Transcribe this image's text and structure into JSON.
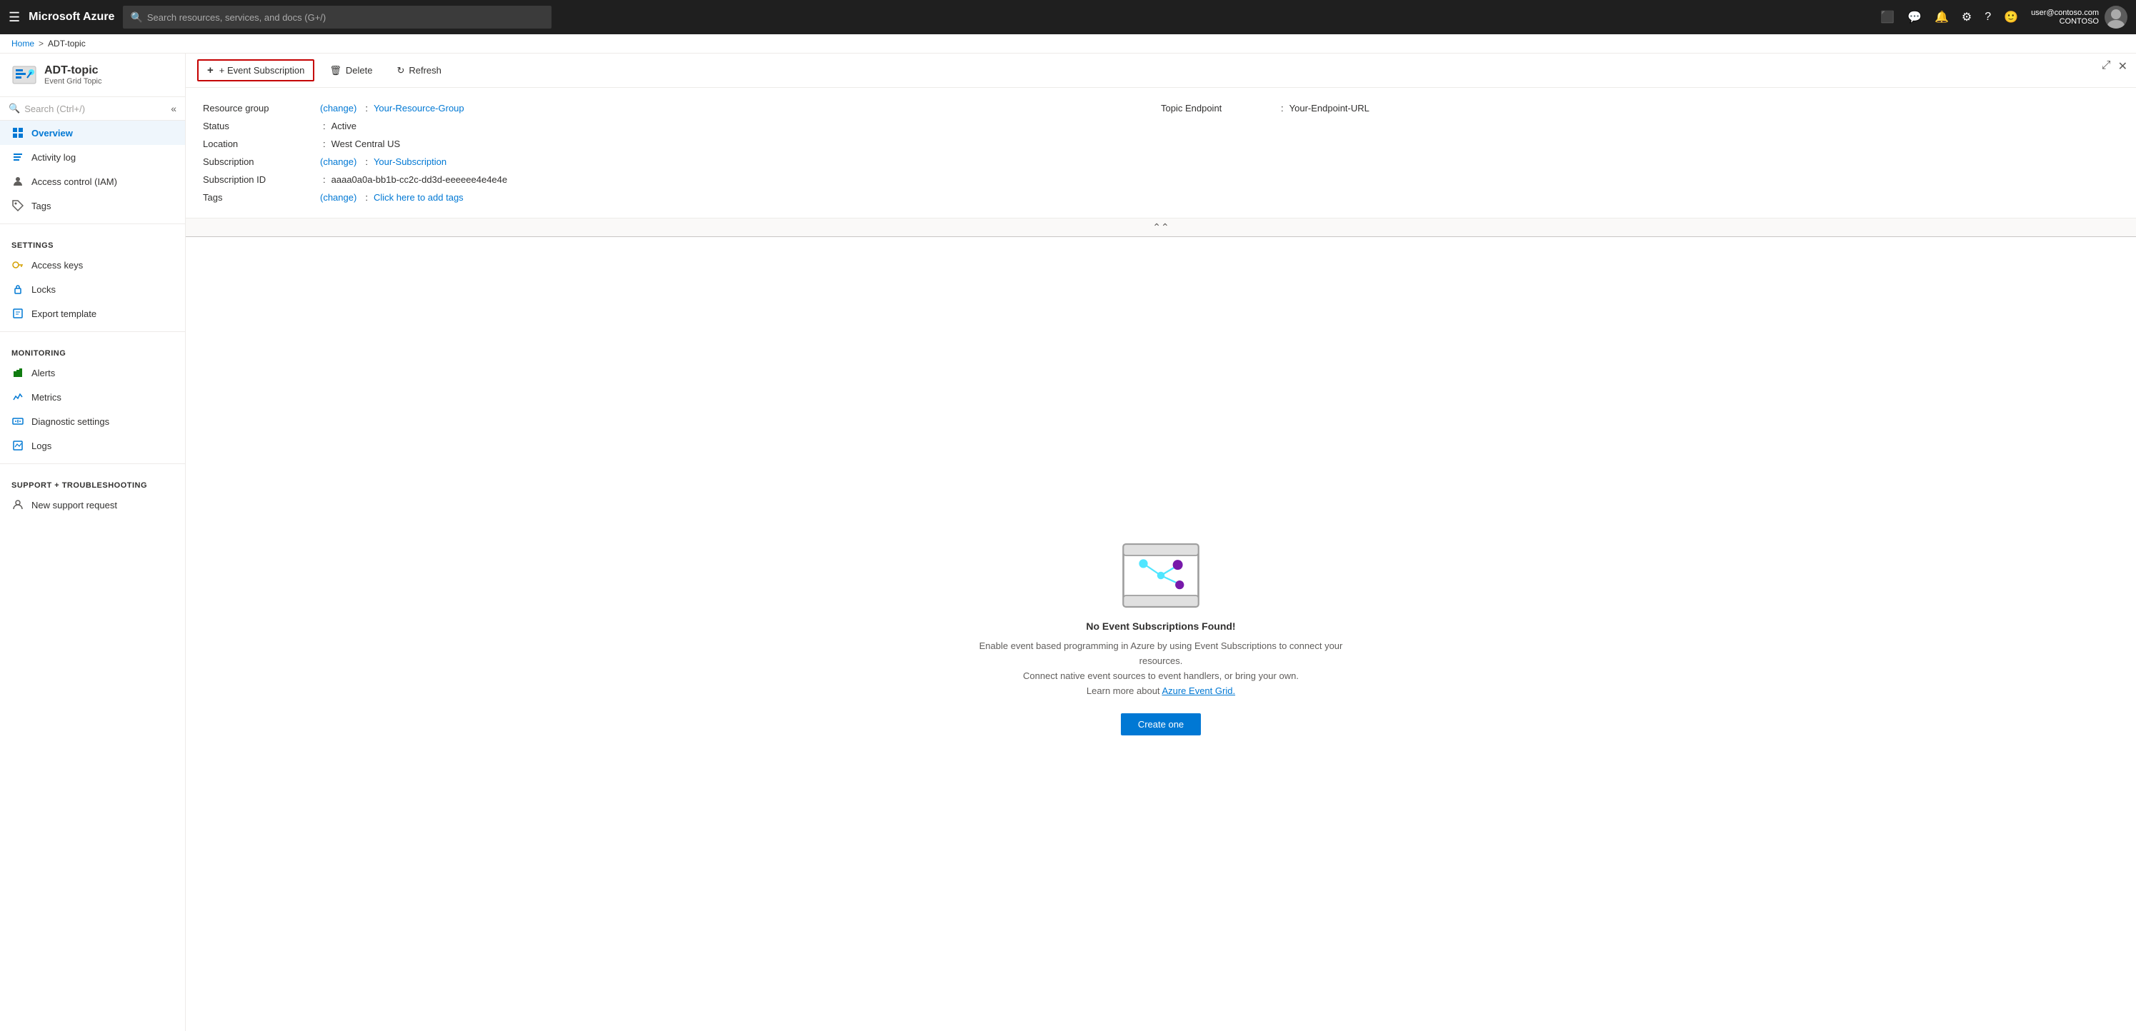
{
  "topbar": {
    "menu_icon": "☰",
    "logo": "Microsoft Azure",
    "search_placeholder": "Search resources, services, and docs (G+/)",
    "user_email": "user@contoso.com",
    "user_org": "CONTOSO",
    "icons": [
      "cloud-shell",
      "feedback",
      "notifications",
      "settings",
      "help",
      "smiley"
    ]
  },
  "breadcrumb": {
    "home": "Home",
    "separator": ">",
    "current": "ADT-topic"
  },
  "resource": {
    "title": "ADT-topic",
    "subtitle": "Event Grid Topic",
    "icon_color": "#0078d4"
  },
  "sidebar_search": {
    "placeholder": "Search (Ctrl+/)"
  },
  "nav": {
    "items": [
      {
        "id": "overview",
        "label": "Overview",
        "icon": "📋",
        "active": true,
        "section": null
      },
      {
        "id": "activity-log",
        "label": "Activity log",
        "icon": "📃",
        "active": false,
        "section": null
      },
      {
        "id": "access-control",
        "label": "Access control (IAM)",
        "icon": "👤",
        "active": false,
        "section": null
      },
      {
        "id": "tags",
        "label": "Tags",
        "icon": "🏷",
        "active": false,
        "section": null
      },
      {
        "id": "access-keys",
        "label": "Access keys",
        "icon": "🔑",
        "active": false,
        "section": "Settings"
      },
      {
        "id": "locks",
        "label": "Locks",
        "icon": "🔒",
        "active": false,
        "section": null
      },
      {
        "id": "export-template",
        "label": "Export template",
        "icon": "📄",
        "active": false,
        "section": null
      },
      {
        "id": "alerts",
        "label": "Alerts",
        "icon": "🔔",
        "active": false,
        "section": "Monitoring"
      },
      {
        "id": "metrics",
        "label": "Metrics",
        "icon": "📊",
        "active": false,
        "section": null
      },
      {
        "id": "diagnostic-settings",
        "label": "Diagnostic settings",
        "icon": "⚙",
        "active": false,
        "section": null
      },
      {
        "id": "logs",
        "label": "Logs",
        "icon": "📈",
        "active": false,
        "section": null
      },
      {
        "id": "new-support-request",
        "label": "New support request",
        "icon": "👤",
        "active": false,
        "section": "Support + troubleshooting"
      }
    ]
  },
  "toolbar": {
    "event_subscription_label": "+ Event Subscription",
    "delete_label": "Delete",
    "refresh_label": "Refresh"
  },
  "info": {
    "resource_group_label": "Resource group",
    "resource_group_change": "(change)",
    "resource_group_value": "Your-Resource-Group",
    "topic_endpoint_label": "Topic Endpoint",
    "topic_endpoint_sep": ":",
    "topic_endpoint_value": "Your-Endpoint-URL",
    "status_label": "Status",
    "status_value": "Active",
    "location_label": "Location",
    "location_value": "West Central US",
    "subscription_label": "Subscription",
    "subscription_change": "(change)",
    "subscription_value": "Your-Subscription",
    "subscription_id_label": "Subscription ID",
    "subscription_id_value": "aaaa0a0a-bb1b-cc2c-dd3d-eeeeee4e4e4e",
    "tags_label": "Tags",
    "tags_change": "(change)",
    "tags_value": "Click here to add tags"
  },
  "empty_state": {
    "title": "No Event Subscriptions Found!",
    "desc_line1": "Enable event based programming in Azure by using Event Subscriptions to connect your resources.",
    "desc_line2": "Connect native event sources to event handlers, or bring your own.",
    "desc_line3_prefix": "Learn more about ",
    "desc_link": "Azure Event Grid.",
    "create_btn": "Create one"
  }
}
